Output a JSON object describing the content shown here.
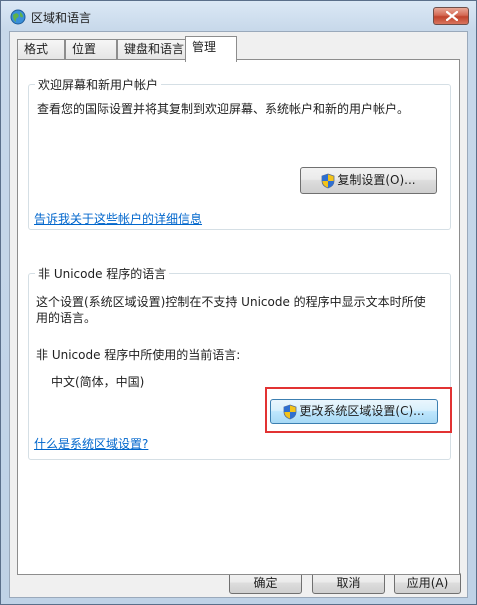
{
  "window": {
    "title": "区域和语言",
    "close_label": "✕"
  },
  "tabs": [
    {
      "label": "格式",
      "active": false
    },
    {
      "label": "位置",
      "active": false
    },
    {
      "label": "键盘和语言",
      "active": false
    },
    {
      "label": "管理",
      "active": true
    }
  ],
  "welcome_group": {
    "title": "欢迎屏幕和新用户帐户",
    "description": "查看您的国际设置并将其复制到欢迎屏幕、系统帐户和新的用户帐户。",
    "copy_button": "复制设置(O)...",
    "info_link": "告诉我关于这些帐户的详细信息"
  },
  "unicode_group": {
    "title": "非 Unicode 程序的语言",
    "description_line1": "这个设置(系统区域设置)控制在不支持 Unicode 的程序中显示文本时所使",
    "description_line2": "用的语言。",
    "current_label": "非 Unicode 程序中所使用的当前语言:",
    "current_value": "中文(简体，中国)",
    "change_button": "更改系统区域设置(C)...",
    "help_link": "什么是系统区域设置?"
  },
  "footer": {
    "ok_button": "确定",
    "cancel_button": "取消",
    "apply_button": "应用(A)"
  },
  "colors": {
    "link": "#0066cc",
    "highlight": "#e23333"
  }
}
